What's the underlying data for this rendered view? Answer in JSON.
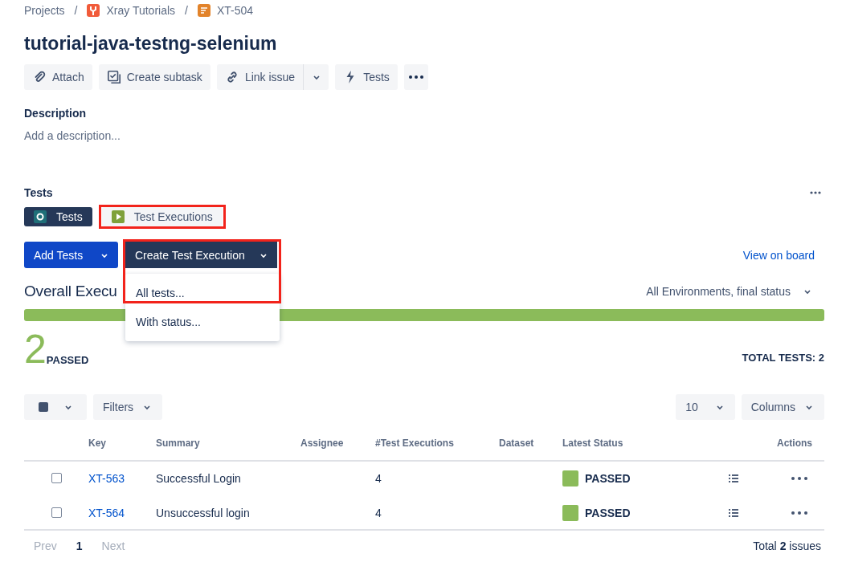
{
  "breadcrumbs": [
    {
      "label": "Projects"
    },
    {
      "separator": "/",
      "label": "Xray Tutorials"
    },
    {
      "separator": "/",
      "label": "XT-504"
    }
  ],
  "title": "tutorial-java-testng-selenium",
  "actions": [
    {
      "label": "Attach"
    },
    {
      "label": "Create subtask"
    },
    {
      "label": "Link issue"
    },
    {
      "label": "Tests"
    }
  ],
  "description": {
    "heading": "Description",
    "placeholder": "Add a description..."
  },
  "tests_panel": {
    "heading": "Tests",
    "tabs": [
      {
        "label": "Tests",
        "selected": true,
        "highlighted": false
      },
      {
        "label": "Test Executions",
        "selected": false,
        "highlighted": true
      }
    ],
    "add_button": "Add Tests",
    "create_button": "Create Test Execution",
    "create_menu": {
      "expanded": true,
      "highlighted": true,
      "items": [
        "All tests...",
        "With status..."
      ]
    },
    "board_link": "View on board"
  },
  "overall": {
    "heading": "Overall Execu",
    "environment": "All Environments, final status",
    "progress": [
      {
        "level": 1,
        "color": "#8bbb5a"
      }
    ],
    "count": "2",
    "count_label": "PASSED",
    "total": "TOTAL TESTS: 2"
  },
  "toolbar": {
    "filters": "Filters",
    "page_size": "10",
    "columns": "Columns"
  },
  "table": {
    "columns": [
      "",
      "Key",
      "Summary",
      "Assignee",
      "#Test Executions",
      "Dataset",
      "Latest Status",
      "",
      "Actions"
    ],
    "rows": [
      {
        "checked": false,
        "key": "XT-563",
        "summary": "Successful Login",
        "assignee": "",
        "executions": "4",
        "dataset": "",
        "status": "PASSED",
        "color": "#8bbb5a"
      },
      {
        "checked": false,
        "key": "XT-564",
        "summary": "Unsuccessful login",
        "assignee": "",
        "executions": "4",
        "dataset": "",
        "status": "PASSED",
        "color": "#8bbb5a"
      }
    ]
  },
  "pagination": {
    "prev": "Prev",
    "page": "1",
    "next": "Next",
    "total": "Total **2** issues"
  }
}
